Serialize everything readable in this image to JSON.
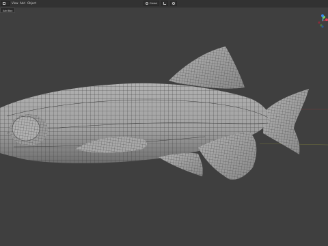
{
  "header": {
    "menu": [
      "View",
      "Add",
      "Object"
    ],
    "active_tool_label": "Add Box",
    "transform_orientation": "Global"
  },
  "colors": {
    "viewport_bg": "#3f3f3f",
    "mesh_fill": "#a6a6a6",
    "wire": "#3a3a3a",
    "axis_x": "#e0415b",
    "axis_y": "#7ad25f",
    "axis_z": "#3b8cf0"
  },
  "icons": [
    "object-mode-icon",
    "transform-global-icon",
    "snap-icon",
    "proportional-icon",
    "navigation-gizmo-icon"
  ]
}
